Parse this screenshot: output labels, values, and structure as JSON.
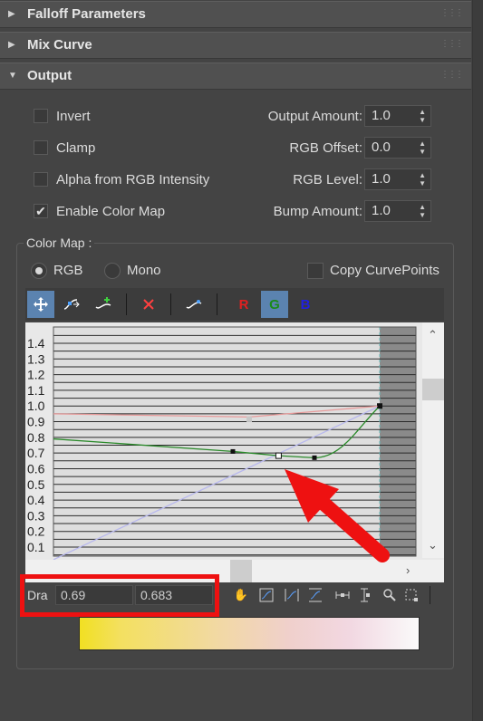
{
  "rollouts": [
    {
      "title": "Falloff Parameters",
      "expanded": false
    },
    {
      "title": "Mix Curve",
      "expanded": false
    },
    {
      "title": "Output",
      "expanded": true
    }
  ],
  "output": {
    "checkboxes": [
      {
        "label": "Invert",
        "checked": false
      },
      {
        "label": "Clamp",
        "checked": false
      },
      {
        "label": "Alpha from RGB Intensity",
        "checked": false
      },
      {
        "label": "Enable Color Map",
        "checked": true
      }
    ],
    "spinners": [
      {
        "label": "Output Amount:",
        "value": "1.0"
      },
      {
        "label": "RGB Offset:",
        "value": "0.0"
      },
      {
        "label": "RGB Level:",
        "value": "1.0"
      },
      {
        "label": "Bump Amount:",
        "value": "1.0"
      }
    ]
  },
  "color_map": {
    "group_label": "Color Map :",
    "modes": [
      {
        "label": "RGB",
        "selected": true
      },
      {
        "label": "Mono",
        "selected": false
      }
    ],
    "copy_curve_points": {
      "label": "Copy CurvePoints",
      "checked": false
    },
    "toolbar": {
      "icons": [
        "move-icon",
        "scale-point-icon",
        "insert-point-icon",
        "delete-point-icon",
        "reset-curve-icon"
      ],
      "channels": [
        {
          "label": "R",
          "color": "#e02020",
          "active": false
        },
        {
          "label": "G",
          "color": "#1a8a1a",
          "active": true
        },
        {
          "label": "B",
          "color": "#2020e0",
          "active": false
        }
      ]
    },
    "y_ticks": [
      "1.4",
      "1.3",
      "1.2",
      "1.1",
      "1.0",
      "0.9",
      "0.8",
      "0.7",
      "0.6",
      "0.5",
      "0.4",
      "0.3",
      "0.2",
      "0.1"
    ],
    "curves": {
      "red": {
        "color": "#e89a9a",
        "points": [
          [
            0.0,
            0.95
          ],
          [
            0.6,
            0.93
          ],
          [
            1.0,
            1.0
          ]
        ]
      },
      "green": {
        "color": "#2a8a2a",
        "points": [
          [
            0.0,
            0.79
          ],
          [
            0.55,
            0.71
          ],
          [
            0.69,
            0.683
          ],
          [
            0.8,
            0.67
          ],
          [
            1.0,
            1.0
          ]
        ]
      },
      "blue": {
        "color": "#b8b8ee",
        "points": [
          [
            0.0,
            0.02
          ],
          [
            1.0,
            1.0
          ]
        ]
      }
    },
    "status": {
      "label": "Dra",
      "x_value": "0.69",
      "y_value": "0.683"
    },
    "bottom_icons": [
      "pan-icon",
      "zoom-extents-icon",
      "zoom-horizontal-extents-icon",
      "zoom-vertical-extents-icon",
      "zoom-horizontal-icon",
      "zoom-vertical-icon",
      "zoom-icon",
      "zoom-region-icon"
    ],
    "gradient_colors": [
      "#f2e022",
      "#f2d9a2",
      "#f0d0cc",
      "#fafafa"
    ]
  },
  "annotation": {
    "color": "#ee1111"
  }
}
